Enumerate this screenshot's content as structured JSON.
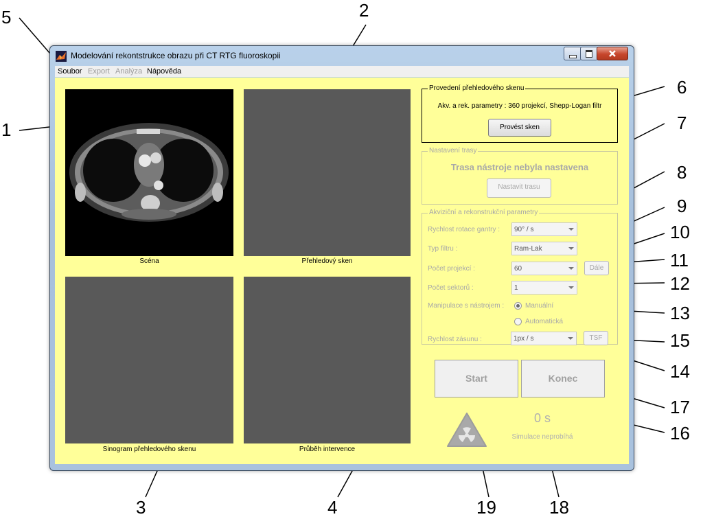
{
  "window": {
    "title": "Modelování rekontstrukce obrazu při CT RTG fluoroskopii"
  },
  "menu": [
    "Soubor",
    "Export",
    "Analýza",
    "Nápověda"
  ],
  "menu_enabled": [
    true,
    false,
    false,
    true
  ],
  "panels": {
    "scene_caption": "Scéna",
    "overview_caption": "Přehledový sken",
    "sinogram_caption": "Sinogram přehledového skenu",
    "intervention_caption": "Průběh intervence"
  },
  "scan_group": {
    "legend": "Provedení přehledového skenu",
    "info": "Akv. a rek. parametry : 360 projekcí, Shepp-Logan filtr",
    "button": "Provést sken"
  },
  "path_group": {
    "legend": "Nastavení trasy",
    "status": "Trasa nástroje nebyla nastavena",
    "button": "Nastavit trasu"
  },
  "params_group": {
    "legend": "Akviziční a rekonstrukční parametry",
    "gantry_label": "Rychlost rotace gantry :",
    "gantry_value": "90° / s",
    "filter_label": "Typ filtru :",
    "filter_value": "Ram-Lak",
    "projections_label": "Počet projekcí :",
    "projections_value": "60",
    "next_button": "Dále",
    "sectors_label": "Počet sektorů :",
    "sectors_value": "1",
    "manip_label": "Manipulace s nástrojem :",
    "manual": "Manuální",
    "automatic": "Automatická",
    "retract_label": "Rychlost zásunu :",
    "retract_value": "1px / s",
    "tsf_button": "TSF"
  },
  "controls": {
    "start": "Start",
    "end": "Konec",
    "timer": "0 s",
    "sim_status": "Simulace neprobíhá"
  },
  "icons": [
    "app-icon",
    "radiation-icon",
    "minimize-icon",
    "maximize-icon",
    "close-icon"
  ],
  "callouts": [
    "1",
    "2",
    "3",
    "4",
    "5",
    "6",
    "7",
    "8",
    "9",
    "10",
    "11",
    "12",
    "13",
    "14",
    "15",
    "16",
    "17",
    "18",
    "19"
  ]
}
